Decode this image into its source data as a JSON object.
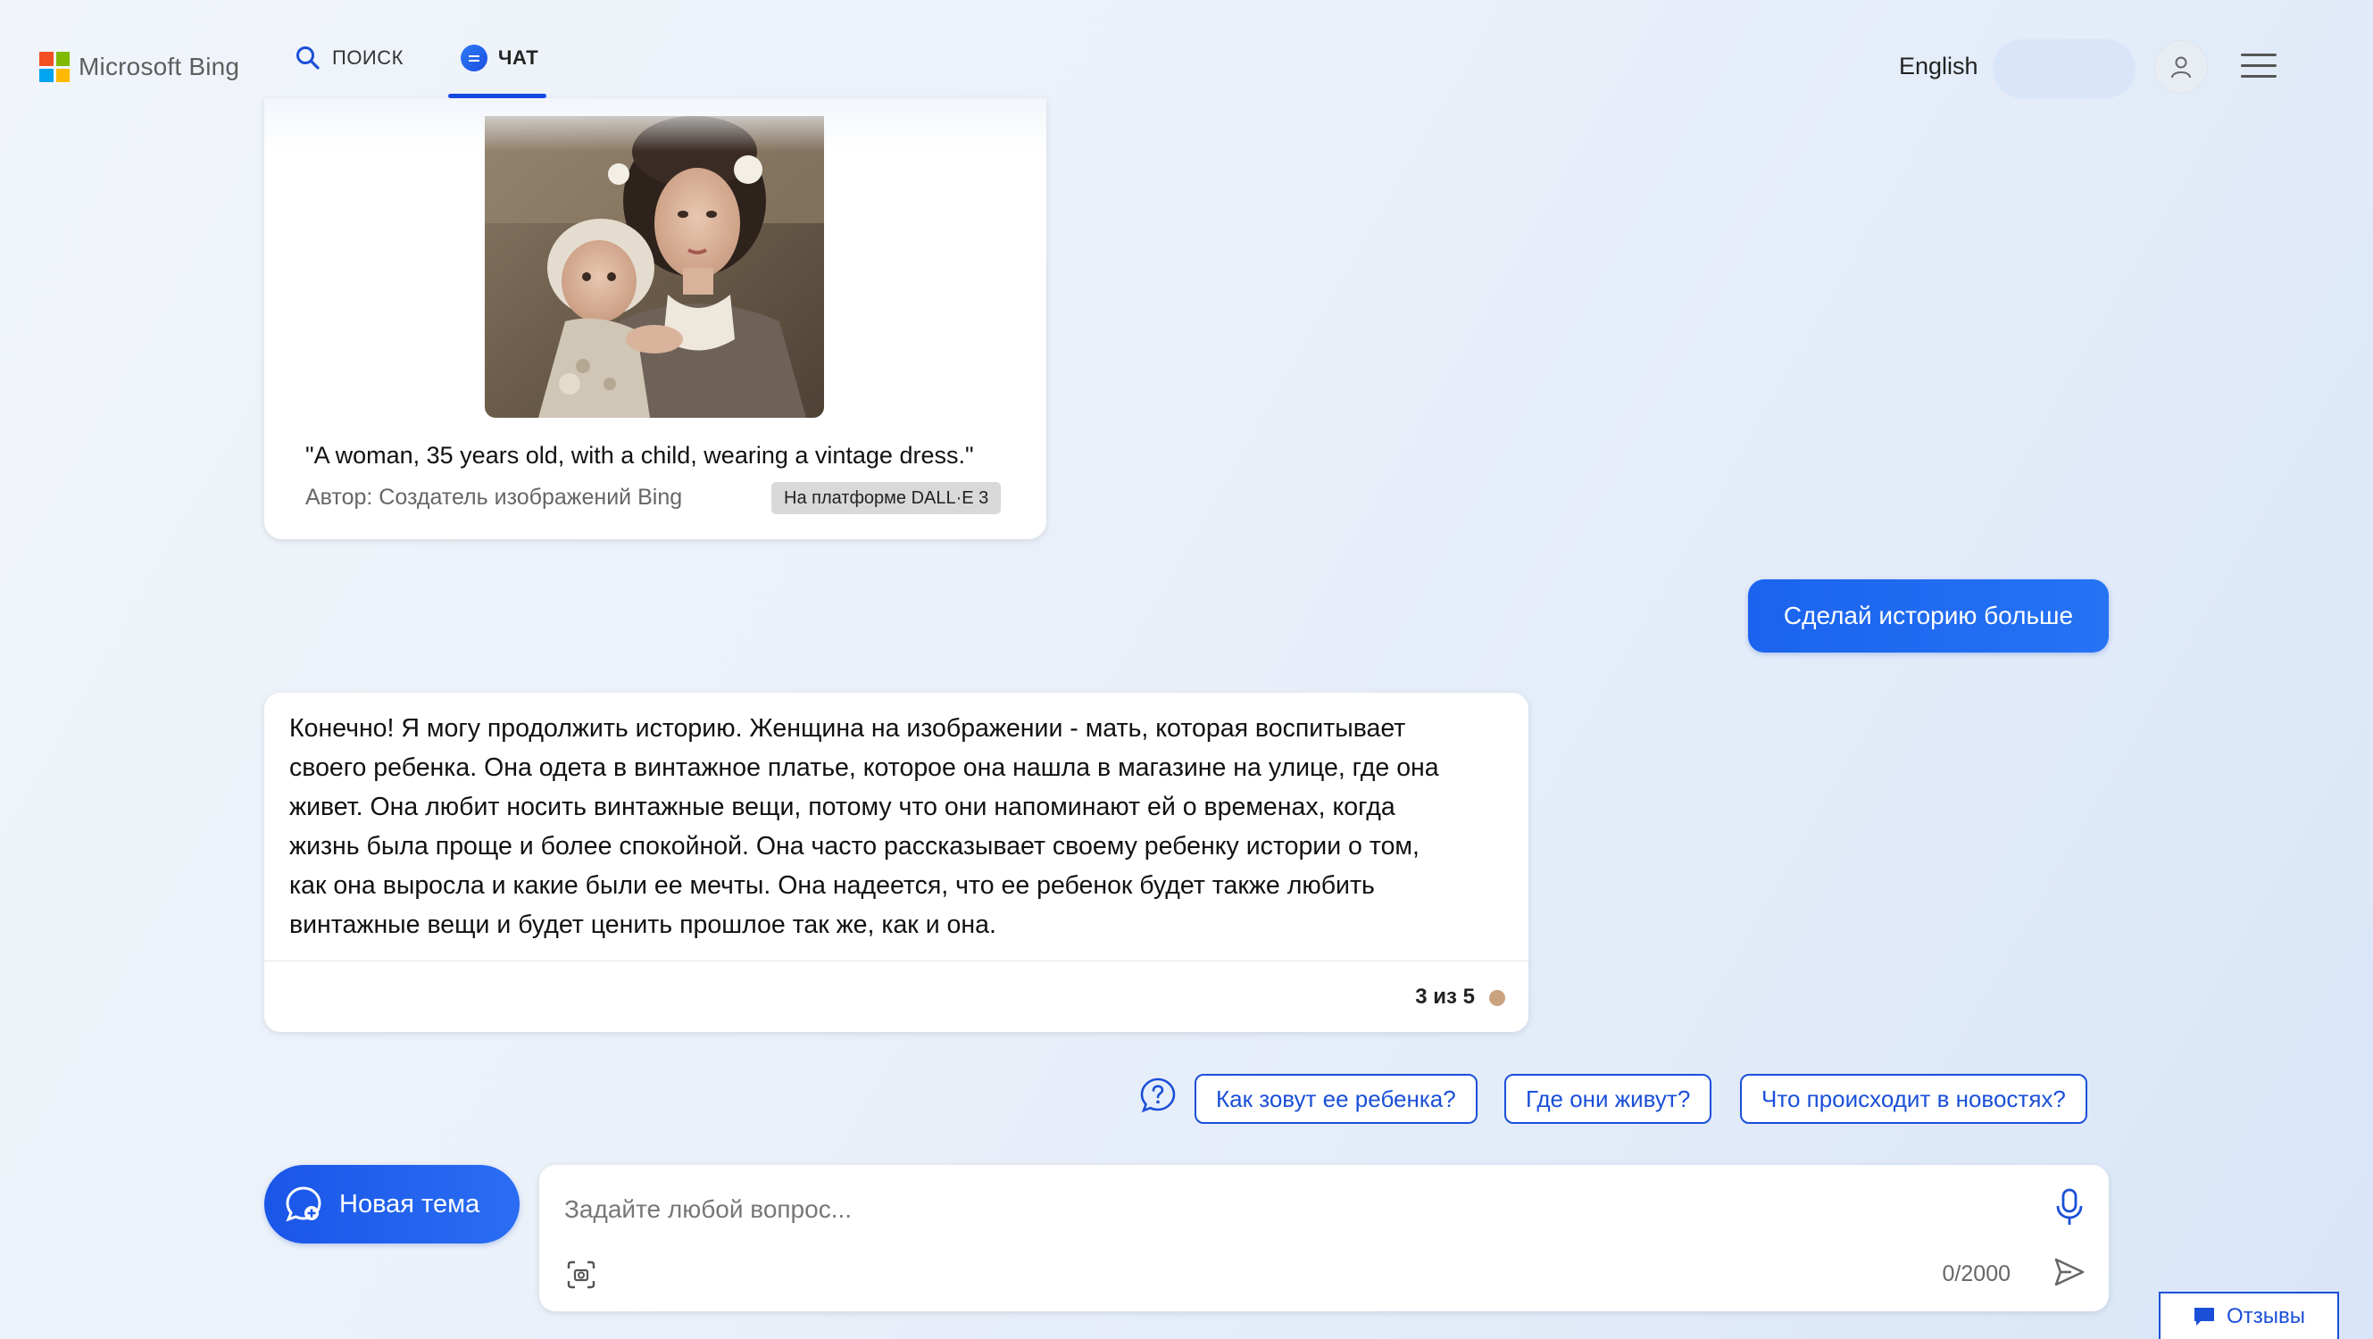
{
  "header": {
    "brand": "Microsoft Bing",
    "tabs": [
      {
        "label": "ПОИСК",
        "icon": "search-icon",
        "active": false
      },
      {
        "label": "ЧАТ",
        "icon": "chat-bubble-icon",
        "active": true
      }
    ],
    "language": "English",
    "accent_color": "#174ae4"
  },
  "image_card": {
    "prompt": "\"A woman, 35 years old, with a child, wearing a vintage dress.\"",
    "author": "Автор: Создатель изображений Bing",
    "badge": "На платформе DALL·E 3"
  },
  "user_message": {
    "text": "Сделай историю больше"
  },
  "bot_message": {
    "lines": [
      "Конечно! Я могу продолжить историю. Женщина на изображении - мать, которая воспитывает",
      "своего ребенка. Она одета в винтажное платье, которое она нашла в магазине на улице, где она",
      "живет. Она любит носить винтажные вещи, потому что они напоминают ей о временах, когда",
      "жизнь была проще и более спокойной. Она часто рассказывает своему ребенку истории о том,",
      "как она выросла и какие были ее мечты. Она надеется, что ее ребенок будет также любить",
      "винтажные вещи и будет ценить прошлое так же, как и она."
    ],
    "counter": "3 из 5",
    "counter_dot_color": "#c9a27e"
  },
  "suggestions": [
    "Как зовут ее ребенка?",
    "Где они живут?",
    "Что происходит в новостях?"
  ],
  "composer": {
    "new_topic_label": "Новая тема",
    "placeholder": "Задайте любой вопрос...",
    "value": "",
    "char_count": "0/2000"
  },
  "feedback": {
    "label": "Отзывы"
  }
}
